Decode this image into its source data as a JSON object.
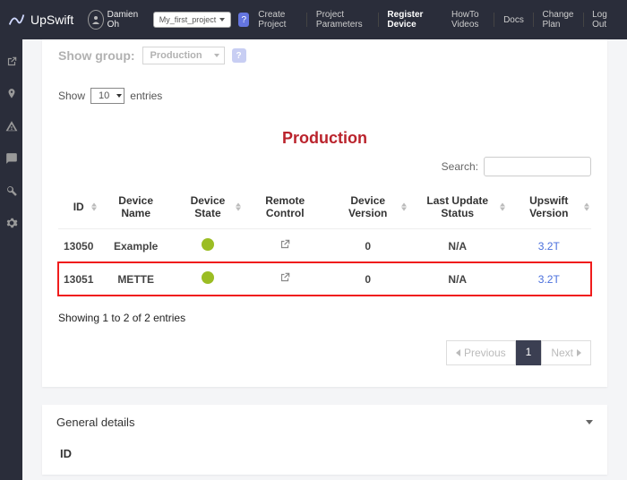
{
  "brand": "UpSwift",
  "user_name": "Damien Oh",
  "project_selected": "My_first_project",
  "nav": {
    "create_project": "Create Project",
    "project_parameters": "Project Parameters",
    "register_device": "Register Device",
    "howto": "HowTo Videos",
    "docs": "Docs",
    "change_plan": "Change Plan",
    "logout": "Log Out"
  },
  "show_group_label": "Show group:",
  "show_group_value": "Production",
  "entries": {
    "show": "Show",
    "count": "10",
    "suffix": "entries"
  },
  "section_title": "Production",
  "search_label": "Search:",
  "columns": [
    "ID",
    "Device Name",
    "Device State",
    "Remote Control",
    "Device Version",
    "Last Update Status",
    "Upswift Version"
  ],
  "rows": [
    {
      "id": "13050",
      "name": "Example",
      "version": "0",
      "last_update": "N/A",
      "upswift": "3.2T"
    },
    {
      "id": "13051",
      "name": "METTE",
      "version": "0",
      "last_update": "N/A",
      "upswift": "3.2T"
    }
  ],
  "info": "Showing 1 to 2 of 2 entries",
  "paginate": {
    "previous": "Previous",
    "page": "1",
    "next": "Next"
  },
  "details_title": "General details",
  "details_sub": "ID"
}
